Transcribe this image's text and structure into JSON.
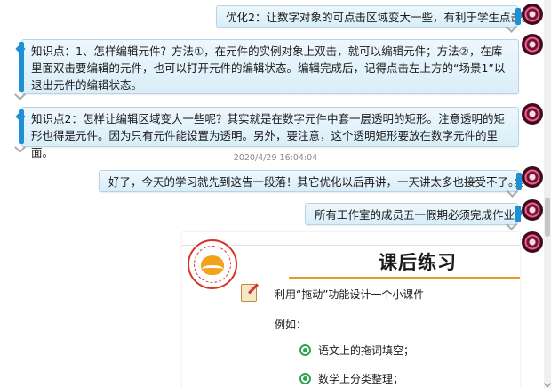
{
  "messages": [
    {
      "side": "right",
      "text": "优化2：让数字对象的可点击区域变大一些，有利于学生点击。"
    },
    {
      "side": "left",
      "text": "知识点：1、怎样编辑元件？方法①，在元件的实例对象上双击，就可以编辑元件；方法②，在库里面双击要编辑的元件，也可以打开元件的编辑状态。编辑完成后，记得点击左上方的“场景1”以退出元件的编辑状态。"
    },
    {
      "side": "left",
      "text": "知识点2：怎样让编辑区域变大一些呢？其实就是在数字元件中套一层透明的矩形。注意透明的矩形也得是元件。因为只有元件能设置为透明。另外，要注意，这个透明矩形要放在数字元件的里面。"
    },
    {
      "side": "right",
      "text": "好了，今天的学习就先到这告一段落！其它优化以后再讲，一天讲太多也接受不了。。。"
    },
    {
      "side": "right",
      "text": "所有工作室的成员五一假期必须完成作业："
    }
  ],
  "timestamp": "2020/4/29 16:04:04",
  "slide": {
    "title": "课后练习",
    "task": "利用“拖动”功能设计一个小课件",
    "example_label": "例如：",
    "items": [
      "语文上的拖词填空；",
      "数学上分类整理；"
    ]
  },
  "colors": {
    "bubble_edge": "#1d8fd2",
    "bubble_bg": "#e3f2fb",
    "slide_rule": "#e89a29",
    "bullet": "#2ea44f"
  },
  "icons": [
    "avatar",
    "school-logo",
    "task-icon",
    "bullet-icon"
  ]
}
